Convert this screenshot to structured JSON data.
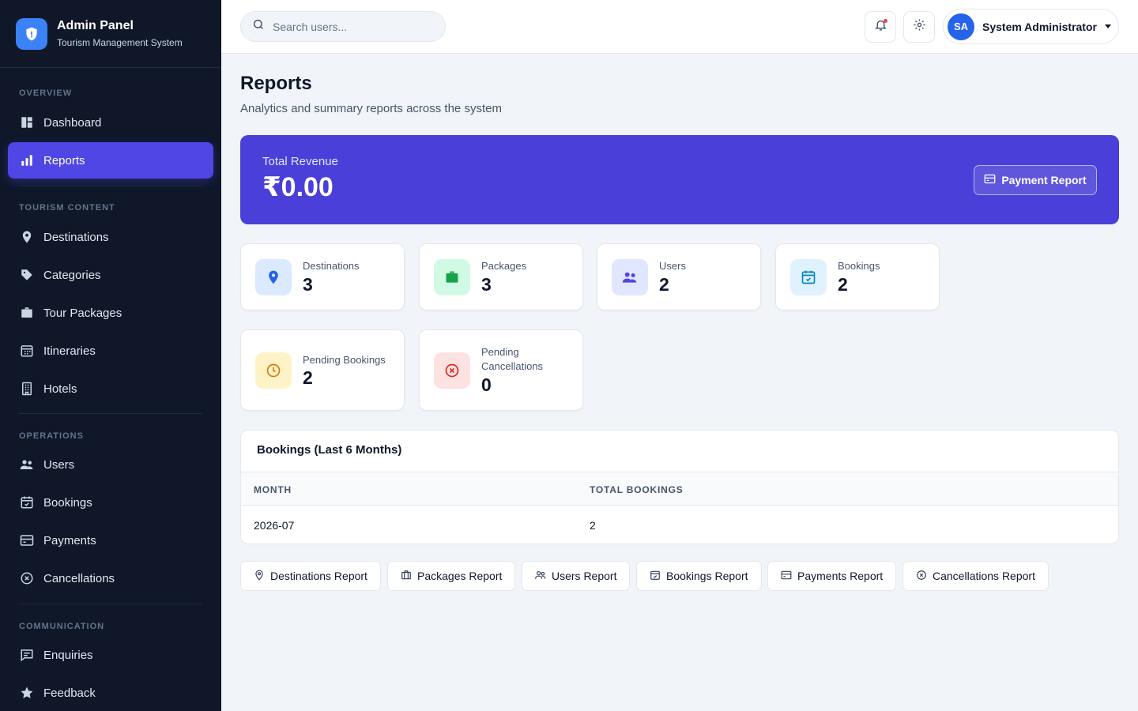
{
  "brand": {
    "title": "Admin Panel",
    "subtitle": "Tourism Management System"
  },
  "sidebar": {
    "sections": [
      {
        "label": "OVERVIEW"
      },
      {
        "label": "TOURISM CONTENT"
      },
      {
        "label": "OPERATIONS"
      },
      {
        "label": "COMMUNICATION"
      }
    ],
    "items": [
      {
        "label": "Dashboard",
        "icon": "dashboard-icon"
      },
      {
        "label": "Reports",
        "icon": "bar-chart-icon",
        "active": true
      },
      {
        "label": "Destinations",
        "icon": "map-pin-icon"
      },
      {
        "label": "Categories",
        "icon": "tag-icon"
      },
      {
        "label": "Tour Packages",
        "icon": "briefcase-icon"
      },
      {
        "label": "Itineraries",
        "icon": "calendar-grid-icon"
      },
      {
        "label": "Hotels",
        "icon": "building-icon"
      },
      {
        "label": "Users",
        "icon": "users-icon"
      },
      {
        "label": "Bookings",
        "icon": "calendar-check-icon"
      },
      {
        "label": "Payments",
        "icon": "payment-card-icon"
      },
      {
        "label": "Cancellations",
        "icon": "cancel-circle-icon"
      },
      {
        "label": "Enquiries",
        "icon": "message-icon"
      },
      {
        "label": "Feedback",
        "icon": "star-icon"
      }
    ]
  },
  "topbar": {
    "search_placeholder": "Search users...",
    "user": {
      "initials": "SA",
      "name": "System Administrator"
    }
  },
  "page": {
    "title": "Reports",
    "subtitle": "Analytics and summary reports across the system"
  },
  "revenue": {
    "label": "Total Revenue",
    "value": "₹0.00",
    "button": "Payment Report"
  },
  "stats": [
    {
      "label": "Destinations",
      "value": "3",
      "icon": "map-pin-icon",
      "color": "#2563eb",
      "bg": "#dbeafe"
    },
    {
      "label": "Packages",
      "value": "3",
      "icon": "briefcase-icon",
      "color": "#16a34a",
      "bg": "#d1fae5"
    },
    {
      "label": "Users",
      "value": "2",
      "icon": "users-icon",
      "color": "#4f46e5",
      "bg": "#e0e7ff"
    },
    {
      "label": "Bookings",
      "value": "2",
      "icon": "calendar-check-icon",
      "color": "#0284c7",
      "bg": "#e0f2fe"
    },
    {
      "label": "Pending Bookings",
      "value": "2",
      "icon": "clock-icon",
      "color": "#d97706",
      "bg": "#fef3c7"
    },
    {
      "label": "Pending Cancellations",
      "value": "0",
      "icon": "cancel-circle-icon",
      "color": "#dc2626",
      "bg": "#fee2e2"
    }
  ],
  "bookings_table": {
    "title": "Bookings (Last 6 Months)",
    "columns": [
      "MONTH",
      "TOTAL BOOKINGS"
    ],
    "rows": [
      [
        "2026-07",
        "2"
      ]
    ]
  },
  "report_buttons": [
    {
      "label": "Destinations Report",
      "icon": "map-pin-icon"
    },
    {
      "label": "Packages Report",
      "icon": "briefcase-icon"
    },
    {
      "label": "Users Report",
      "icon": "users-icon"
    },
    {
      "label": "Bookings Report",
      "icon": "calendar-check-icon"
    },
    {
      "label": "Payments Report",
      "icon": "payment-card-icon"
    },
    {
      "label": "Cancellations Report",
      "icon": "cancel-circle-icon"
    }
  ],
  "colors": {
    "sidebar_bg": "#0f1729",
    "accent": "#4f46e5",
    "revenue_bg": "#4a3fd8",
    "page_bg": "#f1f4f9"
  }
}
